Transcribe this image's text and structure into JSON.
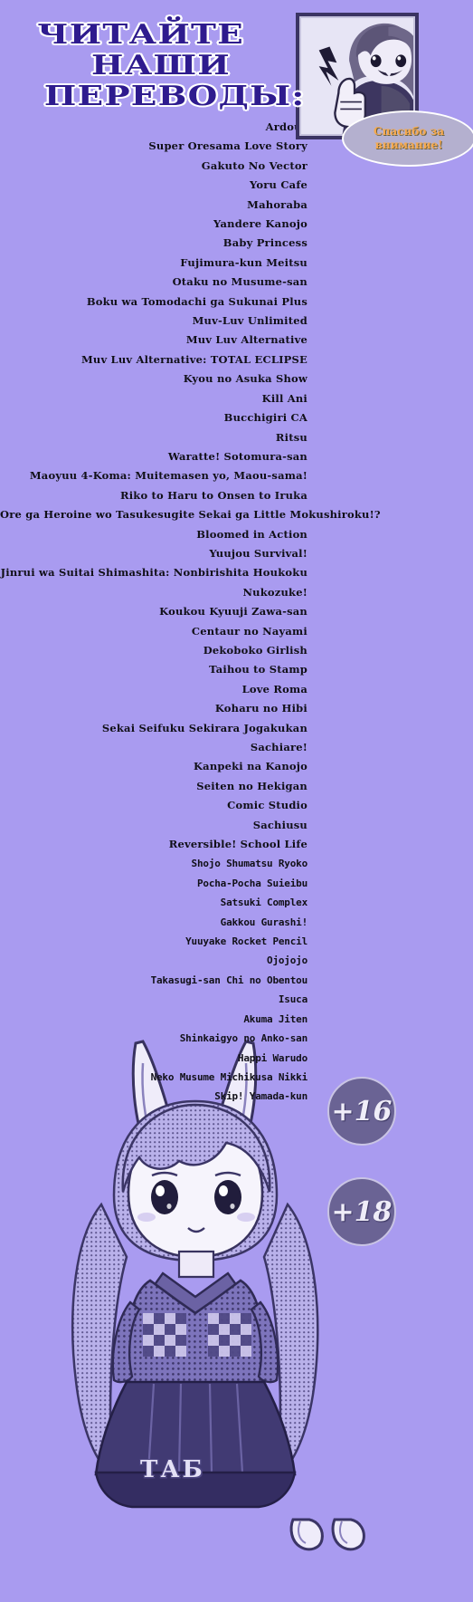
{
  "background_color": "#a99bf0",
  "header": {
    "title_lines": [
      "ЧИТАЙТЕ",
      "НАШИ",
      "ПЕРЕВОДЫ:"
    ],
    "title_color": "#2e1b8e",
    "title_outline_color": "#ffffff"
  },
  "author_photo": {
    "alt_name": "manga-girl-thumbs-up",
    "frame_color": "#3b3463",
    "background_color": "#e6e4f4"
  },
  "thanks_bubble": {
    "line1": "Спасибо за",
    "line2": "внимание!",
    "text_color": "#f5a94e",
    "fill_color": "#b4b0cf"
  },
  "titles": [
    "Ardour",
    "Super Oresama Love Story",
    "Gakuto No Vector",
    "Yoru Cafe",
    "Mahoraba",
    "Yandere Kanojo",
    "Baby Princess",
    "Fujimura-kun Meitsu",
    "Otaku no Musume-san",
    "Boku wa Tomodachi ga Sukunai Plus",
    "Muv-Luv Unlimited",
    "Muv Luv Alternative",
    "Muv Luv Alternative: TOTAL ECLIPSE",
    "Kyou no Asuka Show",
    "Kill Ani",
    "Bucchigiri CA",
    "Ritsu",
    "Waratte! Sotomura-san",
    "Maoyuu 4-Koma: Muitemasen yo, Maou-sama!",
    "Riko to Haru to Onsen to Iruka",
    "Ore ga Heroine wo Tasukesugite Sekai ga Little Mokushiroku!?",
    "Bloomed in Action",
    "Yuujou Survival!",
    "Jinrui wa Suitai Shimashita: Nonbirishita Houkoku",
    "Nukozuke!",
    "Koukou Kyuuji Zawa-san",
    "Centaur no Nayami",
    "Dekoboko Girlish",
    "Taihou to Stamp",
    "Love Roma",
    "Koharu no Hibi",
    "Sekai Seifuku Sekirara Jogakukan",
    "Sachiare!",
    "Kanpeki na Kanojo",
    "Seiten no Hekigan",
    "Comic Studio",
    "Sachiusu",
    "Reversible! School Life",
    "Shojo Shumatsu Ryoko",
    "Pocha-Pocha Suieibu",
    "Satsuki Complex",
    "Gakkou Gurashi!",
    "Yuuyake Rocket Pencil",
    "Ojojojo",
    "Takasugi-san Chi no Obentou",
    "Isuca",
    "Akuma Jiten",
    "Shinkaigyo no Anko-san",
    "Happi Warudo",
    "Neko Musume Michikusa Nikki",
    "Skip! Yamada-kun"
  ],
  "badges": [
    {
      "label": "+16",
      "fill": "#6a6394"
    },
    {
      "label": "+18",
      "fill": "#6a6394"
    }
  ],
  "watermark": {
    "text": "ТАБ"
  }
}
